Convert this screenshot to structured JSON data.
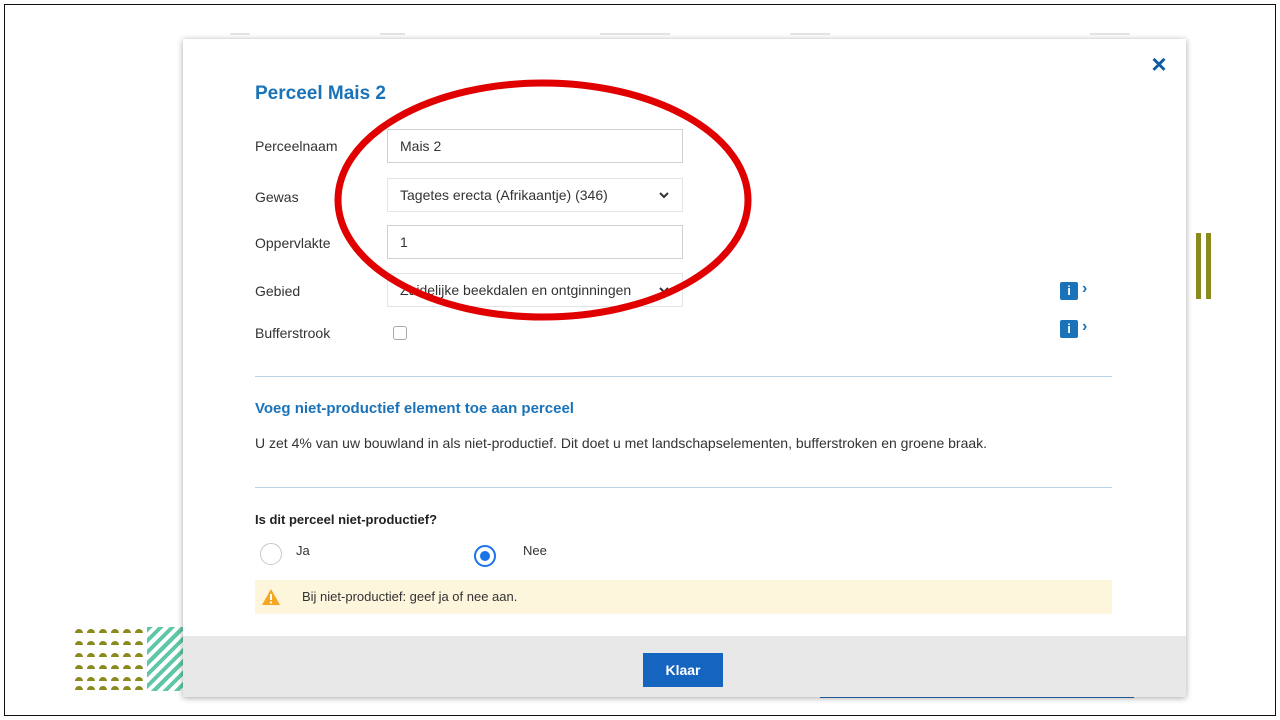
{
  "modal": {
    "title": "Perceel Mais 2",
    "close_symbol": "×",
    "fields": {
      "perceelnaam": {
        "label": "Perceelnaam",
        "value": "Mais 2"
      },
      "gewas": {
        "label": "Gewas",
        "value": "Tagetes erecta (Afrikaantje) (346)"
      },
      "oppervlakte": {
        "label": "Oppervlakte",
        "value": "1"
      },
      "gebied": {
        "label": "Gebied",
        "value": "Zuidelijke beekdalen en ontginningen"
      },
      "bufferstrook": {
        "label": "Bufferstrook",
        "checked": false
      }
    },
    "section_title": "Voeg niet-productief element toe aan perceel",
    "description": "U zet 4% van uw bouwland in als niet-productief. Dit doet u met landschapselementen, bufferstroken en groene braak.",
    "question": "Is dit perceel niet-productief?",
    "options": [
      {
        "label": "Ja",
        "selected": false
      },
      {
        "label": "Nee",
        "selected": true
      }
    ],
    "warning": "Bij niet-productief: geef ja of nee aan.",
    "info_label": "i",
    "done_button": "Klaar"
  },
  "colors": {
    "accent": "#1a73b8",
    "button": "#1565c0",
    "annotation": "#e00000",
    "warning_bg": "#fdf5dc"
  }
}
